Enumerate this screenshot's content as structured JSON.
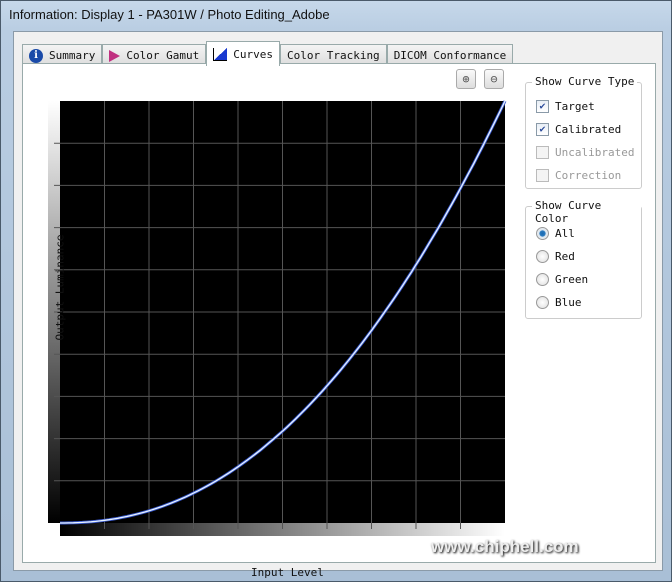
{
  "window": {
    "title": "Information: Display 1 - PA301W / Photo Editing_Adobe"
  },
  "tabs": [
    {
      "label": "Summary",
      "icon": "info-icon"
    },
    {
      "label": "Color Gamut",
      "icon": "color-gamut-icon"
    },
    {
      "label": "Curves",
      "icon": "curves-icon",
      "active": true
    },
    {
      "label": "Color Tracking"
    },
    {
      "label": "DICOM Conformance"
    }
  ],
  "chart_data": {
    "type": "line",
    "xlabel": "Input Level",
    "ylabel": "Output Luminance",
    "grid": true,
    "gamma": 2.2,
    "series": [
      {
        "x": [
          0,
          0.1,
          0.2,
          0.3,
          0.4,
          0.5,
          0.6,
          0.7,
          0.8,
          0.9,
          1
        ],
        "y": [
          0,
          0.006,
          0.029,
          0.071,
          0.133,
          0.218,
          0.325,
          0.456,
          0.612,
          0.793,
          1
        ]
      }
    ]
  },
  "curve_type": {
    "title": "Show Curve Type",
    "items": [
      {
        "label": "Target",
        "checked": true,
        "enabled": true
      },
      {
        "label": "Calibrated",
        "checked": true,
        "enabled": true
      },
      {
        "label": "Uncalibrated",
        "checked": false,
        "enabled": false
      },
      {
        "label": "Correction",
        "checked": false,
        "enabled": false
      }
    ]
  },
  "curve_color": {
    "title": "Show Curve Color",
    "items": [
      {
        "label": "All",
        "selected": true
      },
      {
        "label": "Red",
        "selected": false
      },
      {
        "label": "Green",
        "selected": false
      },
      {
        "label": "Blue",
        "selected": false
      }
    ]
  },
  "watermark": "www.chiphell.com"
}
